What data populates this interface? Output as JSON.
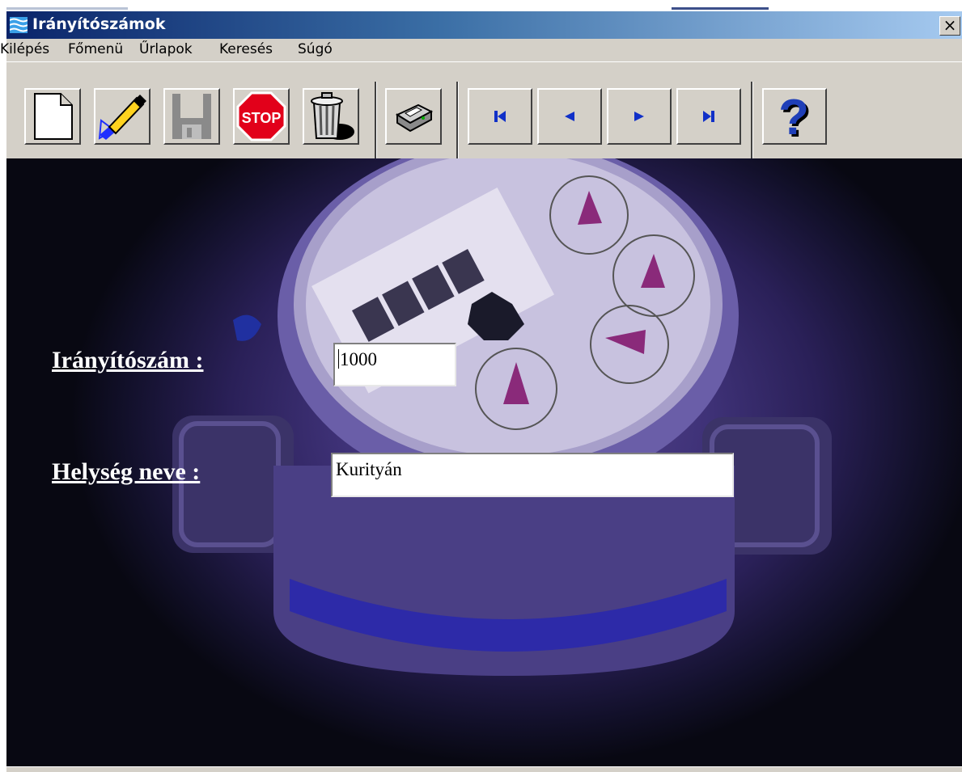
{
  "window": {
    "title": "Irányítószámok",
    "close_glyph": "×"
  },
  "menu": [
    "Kilépés",
    "Főmenü",
    "Űrlapok",
    "Keresés",
    "Súgó"
  ],
  "toolbar": {
    "buttons": [
      {
        "icon": "new-document-icon"
      },
      {
        "icon": "edit-pen-icon"
      },
      {
        "icon": "save-disk-icon"
      },
      {
        "icon": "stop-icon",
        "label": "STOP"
      },
      {
        "icon": "trash-icon"
      },
      {
        "icon": "print-icon"
      },
      {
        "icon": "first-record-icon"
      },
      {
        "icon": "previous-record-icon"
      },
      {
        "icon": "next-record-icon"
      },
      {
        "icon": "last-record-icon"
      },
      {
        "icon": "help-icon",
        "label": "?"
      }
    ]
  },
  "form": {
    "zip_label": "Irányítószám :",
    "zip_value": "1000",
    "city_label": "Helység neve :",
    "city_value": "Kurityán"
  },
  "colors": {
    "title_start": "#0a246a",
    "title_end": "#a6caf0",
    "chrome": "#d4d0c8",
    "stop_red": "#e2001a",
    "nav_blue": "#1030c8"
  }
}
